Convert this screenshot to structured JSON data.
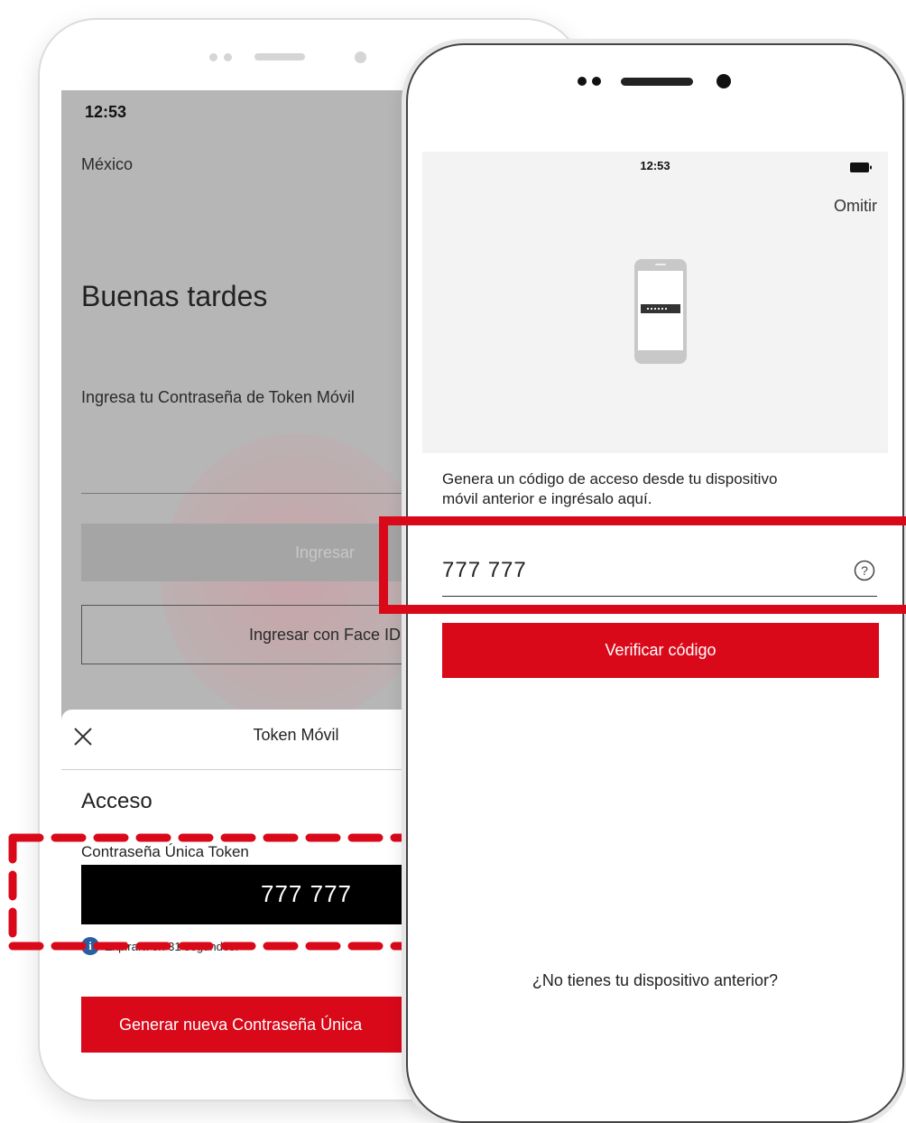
{
  "back_phone": {
    "time": "12:53",
    "region": "México",
    "greeting": "Buenas tardes",
    "prompt": "Ingresa tu Contraseña de Token Móvil",
    "login_button": "Ingresar",
    "faceid_button": "Ingresar con Face ID",
    "sheet": {
      "title": "Token Móvil",
      "section": "Acceso",
      "token_label": "Contraseña Única Token",
      "token_value": "777 777",
      "expiry_text": "Expirará en 31 segundos.",
      "generate_button": "Generar nueva Contraseña Única"
    }
  },
  "front_phone": {
    "time": "12:53",
    "skip_label": "Omitir",
    "instruction_line1": "Genera un código de acceso desde tu dispositivo",
    "instruction_line2": "móvil anterior e ingrésalo aquí.",
    "code_value": "777 777",
    "verify_button": "Verificar código",
    "no_device_link": "¿No tienes tu dispositivo anterior?"
  },
  "colors": {
    "accent_red": "#d9091a",
    "back_screen_gray": "#b6b6b6",
    "token_bg": "#000000"
  },
  "icons": [
    "close-icon",
    "info-icon",
    "help-icon",
    "battery-icon",
    "phone-illustration"
  ]
}
